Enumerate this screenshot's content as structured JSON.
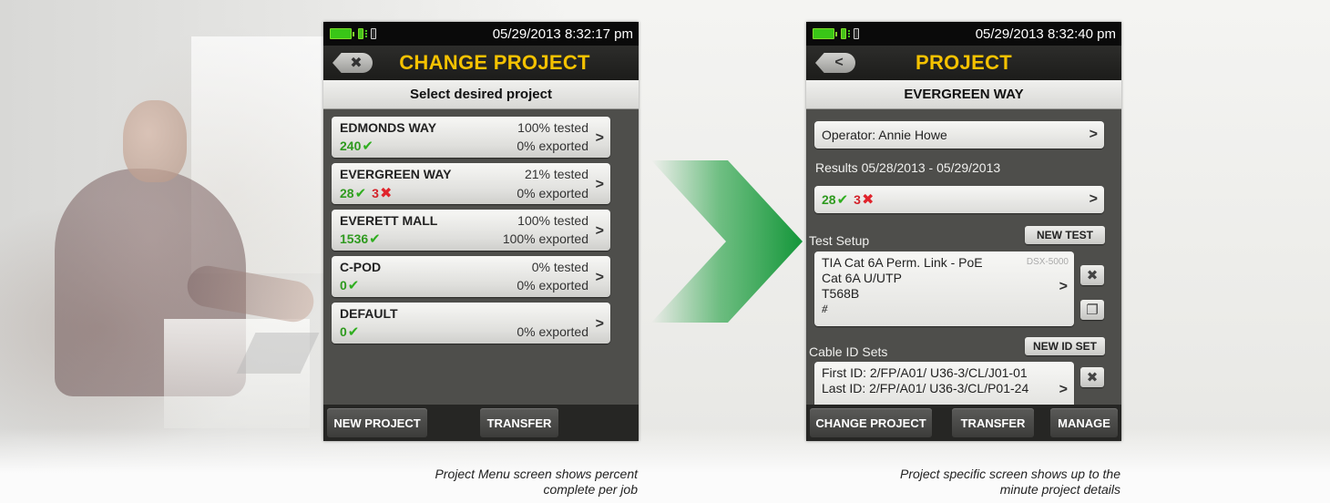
{
  "left_screen": {
    "status_time": "05/29/2013 8:32:17 pm",
    "title": "CHANGE PROJECT",
    "subheader": "Select desired project",
    "projects": [
      {
        "name": "EDMONDS WAY",
        "tested": "100% tested",
        "pass": "240",
        "fail": "",
        "exported": "0% exported"
      },
      {
        "name": "EVERGREEN WAY",
        "tested": "21% tested",
        "pass": "28",
        "fail": "3",
        "exported": "0% exported"
      },
      {
        "name": "EVERETT MALL",
        "tested": "100% tested",
        "pass": "1536",
        "fail": "",
        "exported": "100% exported"
      },
      {
        "name": "C-POD",
        "tested": "0% tested",
        "pass": "0",
        "fail": "",
        "exported": "0% exported"
      },
      {
        "name": "DEFAULT",
        "tested": "",
        "pass": "0",
        "fail": "",
        "exported": "0% exported"
      }
    ],
    "footer": {
      "new_project": "NEW PROJECT",
      "transfer": "TRANSFER"
    }
  },
  "right_screen": {
    "status_time": "05/29/2013 8:32:40 pm",
    "title": "PROJECT",
    "subheader": "EVERGREEN WAY",
    "operator": "Operator: Annie Howe",
    "results_label": "Results 05/28/2013 - 05/29/2013",
    "results": {
      "pass": "28",
      "fail": "3"
    },
    "test_setup_label": "Test Setup",
    "new_test": "NEW TEST",
    "setup": {
      "line1": "TIA Cat 6A Perm. Link - PoE",
      "line2": "Cat 6A U/UTP",
      "line3": "T568B",
      "model": "DSX-5000"
    },
    "cable_id_label": "Cable ID Sets",
    "new_id_set": "NEW ID SET",
    "cable_ids": {
      "first": "First ID: 2/FP/A01/ U36-3/CL/J01-01",
      "last": "Last ID: 2/FP/A01/ U36-3/CL/P01-24"
    },
    "footer": {
      "change_project": "CHANGE PROJECT",
      "transfer": "TRANSFER",
      "manage": "MANAGE"
    }
  },
  "captions": {
    "left_line1": "Project Menu screen shows percent",
    "left_line2": "complete per job",
    "right_line1": "Project specific screen shows up to the",
    "right_line2": "minute project details"
  },
  "colors": {
    "title_yellow": "#f5c200",
    "pass_green": "#2fae1f",
    "fail_red": "#e0242c",
    "arrow_green": "#1a9e3c"
  },
  "icons": {
    "pass": "checkmark-icon",
    "fail": "x-mark-icon",
    "back": "back-arrow-icon",
    "chevron": "chevron-right-icon"
  }
}
